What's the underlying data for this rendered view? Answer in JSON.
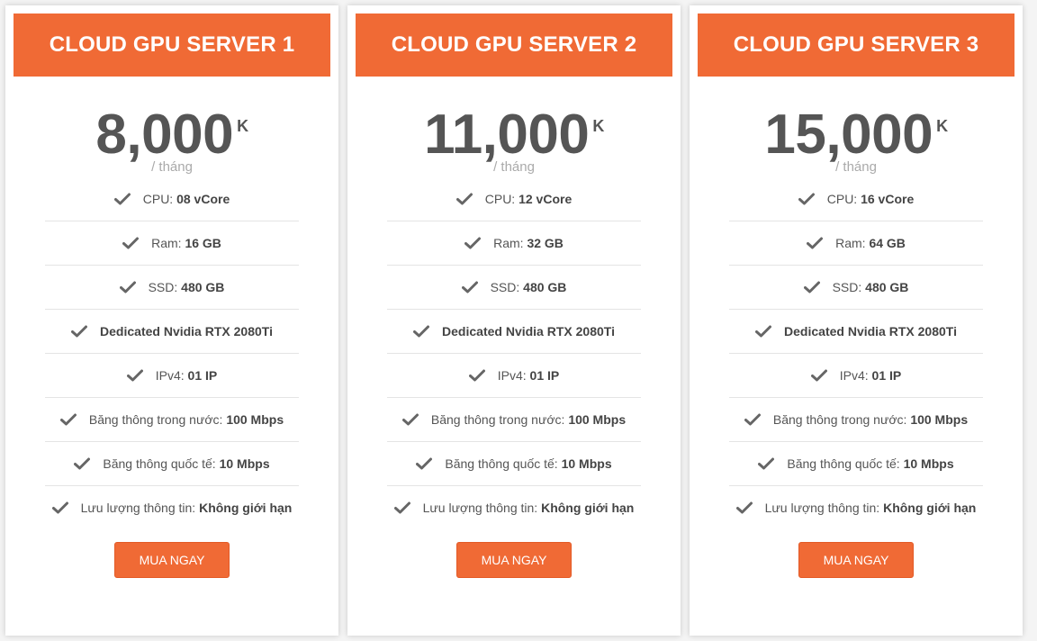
{
  "accent_color": "#f06a35",
  "plans": [
    {
      "title": "CLOUD GPU SERVER 1",
      "price": "8,000",
      "unit": "K",
      "period": "/ tháng",
      "features": [
        {
          "label": "CPU:",
          "value": "08 vCore"
        },
        {
          "label": "Ram:",
          "value": "16 GB"
        },
        {
          "label": "SSD:",
          "value": "480 GB"
        },
        {
          "label": "",
          "value": "Dedicated Nvidia RTX 2080Ti"
        },
        {
          "label": "IPv4:",
          "value": "01 IP"
        },
        {
          "label": "Băng thông trong nước:",
          "value": "100 Mbps"
        },
        {
          "label": "Băng thông quốc tế:",
          "value": "10 Mbps"
        },
        {
          "label": "Lưu lượng thông tin:",
          "value": "Không giới hạn"
        }
      ],
      "button": "MUA NGAY"
    },
    {
      "title": "CLOUD GPU SERVER 2",
      "price": "11,000",
      "unit": "K",
      "period": "/ tháng",
      "features": [
        {
          "label": "CPU:",
          "value": "12 vCore"
        },
        {
          "label": "Ram:",
          "value": "32 GB"
        },
        {
          "label": "SSD:",
          "value": "480 GB"
        },
        {
          "label": "",
          "value": "Dedicated Nvidia RTX 2080Ti"
        },
        {
          "label": "IPv4:",
          "value": "01 IP"
        },
        {
          "label": "Băng thông trong nước:",
          "value": "100 Mbps"
        },
        {
          "label": "Băng thông quốc tế:",
          "value": "10 Mbps"
        },
        {
          "label": "Lưu lượng thông tin:",
          "value": "Không giới hạn"
        }
      ],
      "button": "MUA NGAY"
    },
    {
      "title": "CLOUD GPU SERVER 3",
      "price": "15,000",
      "unit": "K",
      "period": "/ tháng",
      "features": [
        {
          "label": "CPU:",
          "value": "16 vCore"
        },
        {
          "label": "Ram:",
          "value": "64 GB"
        },
        {
          "label": "SSD:",
          "value": "480 GB"
        },
        {
          "label": "",
          "value": "Dedicated Nvidia RTX 2080Ti"
        },
        {
          "label": "IPv4:",
          "value": "01 IP"
        },
        {
          "label": "Băng thông trong nước:",
          "value": "100 Mbps"
        },
        {
          "label": "Băng thông quốc tế:",
          "value": "10 Mbps"
        },
        {
          "label": "Lưu lượng thông tin:",
          "value": "Không giới hạn"
        }
      ],
      "button": "MUA NGAY"
    }
  ]
}
